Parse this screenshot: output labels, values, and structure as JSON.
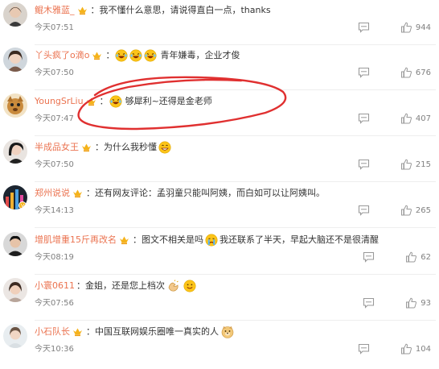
{
  "comments": [
    {
      "user": "鲲木雅蓝_",
      "sep": "：",
      "text": "我不懂什么意思，请说得直白一点，thanks",
      "time": "今天07:51",
      "likes": "944",
      "emojis": []
    },
    {
      "user": "丫头疯了o滴o",
      "sep": "：",
      "text": "青年嫌毒，企业才俊",
      "time": "今天07:50",
      "likes": "676",
      "emojis": [
        "laugh-tears",
        "laugh-tears",
        "laugh-tears"
      ]
    },
    {
      "user": "YoungSrLiu",
      "sep": "：",
      "text": "够犀利~还得是金老师",
      "time": "今天07:47",
      "likes": "407",
      "emojis": [
        "laugh-tears"
      ]
    },
    {
      "user": "半成品女王",
      "sep": "：",
      "text": "为什么我秒懂",
      "time": "今天07:50",
      "likes": "215",
      "emojis": [
        "grin"
      ]
    },
    {
      "user": "郑州说说",
      "sep": "：",
      "text": "还有网友评论：孟羽童只能叫阿姨，而白如可以让阿姨叫。",
      "time": "今天14:13",
      "likes": "265",
      "emojis": []
    },
    {
      "user": "增肌增重15斤再改名",
      "sep": "：",
      "text": "图文不相关是吗",
      "text2": "我还联系了半天，早起大脑还不是很清醒",
      "time": "今天08:19",
      "likes": "62",
      "emojis": [
        "cry"
      ]
    },
    {
      "user": "小寰0611",
      "sep": "：",
      "text": "金姐，还是您上档次",
      "time": "今天07:56",
      "likes": "93",
      "emojis": [
        "clap",
        "smile"
      ]
    },
    {
      "user": "小石队长",
      "sep": "：",
      "text": "中国互联网娱乐圈唯一真实的人",
      "time": "今天10:36",
      "likes": "104",
      "emojis": [
        "doge"
      ]
    }
  ],
  "colors": {
    "username": "#eb7350",
    "time": "#808080",
    "annotation": "#e03030"
  }
}
